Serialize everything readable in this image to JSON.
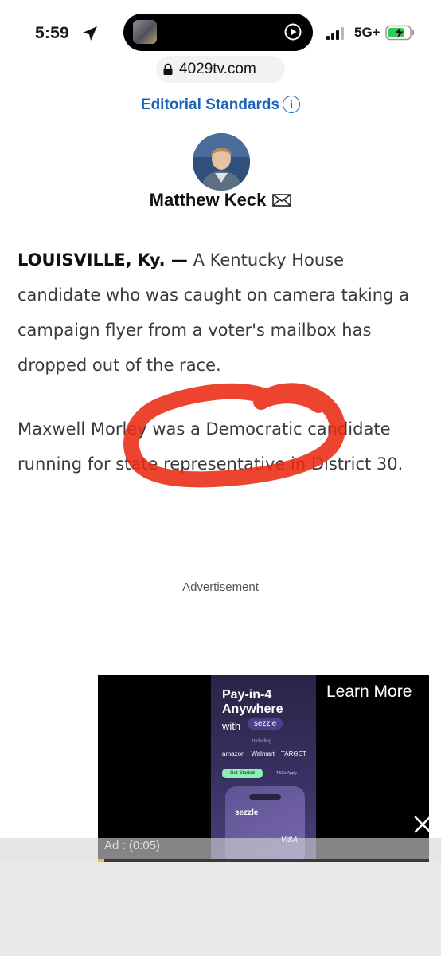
{
  "status_bar": {
    "time": "5:59",
    "network": "5G+",
    "icons": [
      "location-arrow-icon",
      "dynamic-island-play-icon",
      "signal-bars-icon",
      "battery-charging-icon"
    ]
  },
  "browser": {
    "url": "4029tv.com"
  },
  "article": {
    "editorial_link": "Editorial Standards",
    "info_icon": "i",
    "author": "Matthew Keck",
    "dateline": "LOUISVILLE, Ky. —",
    "paragraph1": " A Kentucky House candidate who was caught on camera taking a campaign flyer from a voter's mailbox has dropped out of the race.",
    "paragraph2": "Maxwell Morley was a Democratic candidate running for state representative in District 30.",
    "advertisement_label": "Advertisement"
  },
  "video_ad": {
    "learn_more": "Learn More",
    "time_label": "Ad : (0:05)",
    "progress": 0.02,
    "creative": {
      "headline": "Pay-in-4 Anywhere",
      "with": "with",
      "brand": "sezzle",
      "including": "Including",
      "partners": [
        "amazon",
        "Walmart",
        "TARGET"
      ],
      "cta": "Get Started",
      "terms": "T&Cs Apply",
      "card_brand": "sezzle",
      "card_network": "VISA"
    }
  },
  "colors": {
    "link": "#1d63b8",
    "annotation": "#ea2a12",
    "ad_progress": "#f1c232"
  }
}
